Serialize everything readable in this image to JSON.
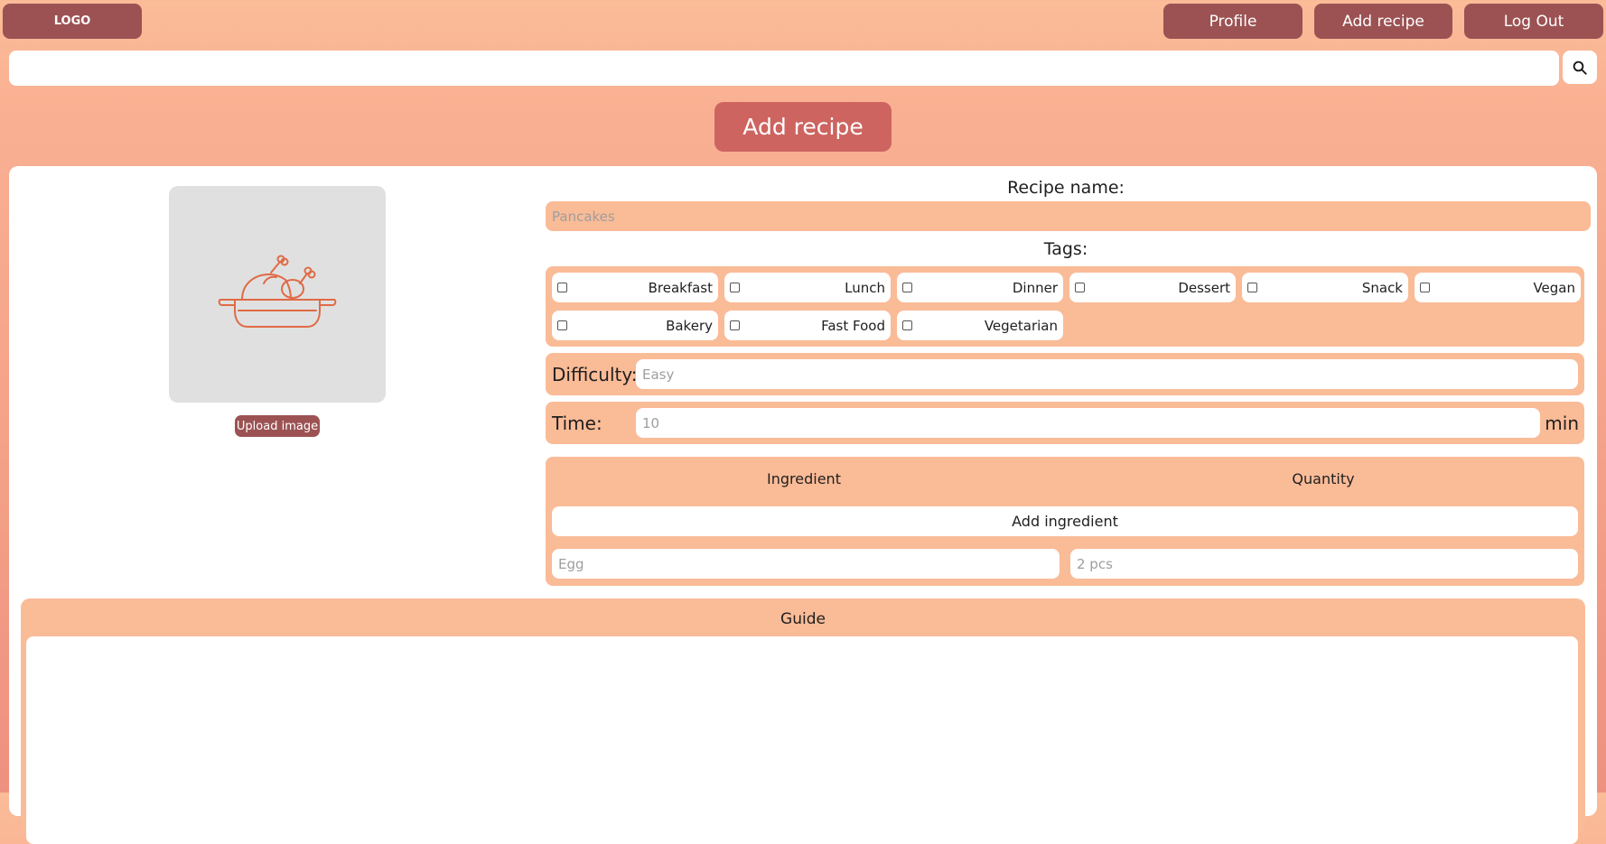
{
  "header": {
    "logo": "LOGO",
    "nav": {
      "profile": "Profile",
      "add_recipe": "Add recipe",
      "logout": "Log Out"
    }
  },
  "search": {
    "placeholder": "",
    "icon": "search-icon"
  },
  "page": {
    "title": "Add recipe"
  },
  "image": {
    "icon": "roast-chicken-icon",
    "upload_label": "Upload image"
  },
  "form": {
    "name_label": "Recipe name:",
    "name_placeholder": "Pancakes",
    "tags_label": "Tags:",
    "tags": [
      "Breakfast",
      "Lunch",
      "Dinner",
      "Dessert",
      "Snack",
      "Vegan",
      "Bakery",
      "Fast Food",
      "Vegetarian"
    ],
    "difficulty_label": "Difficulty:",
    "difficulty_placeholder": "Easy",
    "time_label": "Time:",
    "time_placeholder": "10",
    "time_unit": "min",
    "ingredients": {
      "col_ingredient": "Ingredient",
      "col_quantity": "Quantity",
      "add_label": "Add ingredient",
      "ingredient_placeholder": "Egg",
      "quantity_placeholder": "2 pcs"
    },
    "guide_label": "Guide"
  },
  "colors": {
    "nav_button": "#9c5253",
    "accent_button": "#cd6460",
    "panel": "#fabb97",
    "icon_stroke": "#e06a45"
  }
}
